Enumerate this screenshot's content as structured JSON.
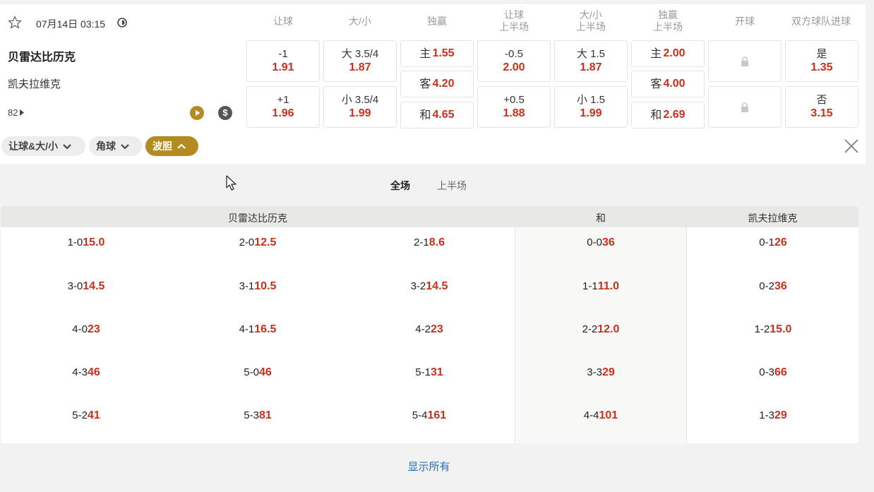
{
  "match": {
    "datetime": "07月14日 03:15",
    "home_team": "贝雷达比历克",
    "away_team": "凯夫拉维克",
    "more_count": "82"
  },
  "columns": [
    "让球",
    "大/小",
    "独赢",
    "让球\n上半场",
    "大/小\n上半场",
    "独赢\n上半场",
    "开球",
    "双方球队进球"
  ],
  "odds": {
    "handicap": [
      {
        "line": "-1",
        "odds": "1.91"
      },
      {
        "line": "+1",
        "odds": "1.96"
      }
    ],
    "total": [
      {
        "line": "大 3.5/4",
        "odds": "1.87"
      },
      {
        "line": "小 3.5/4",
        "odds": "1.99"
      }
    ],
    "moneyline": [
      {
        "label": "主",
        "odds": "1.55"
      },
      {
        "label": "客",
        "odds": "4.20"
      },
      {
        "label": "和",
        "odds": "4.65"
      }
    ],
    "handicap_1h": [
      {
        "line": "-0.5",
        "odds": "2.00"
      },
      {
        "line": "+0.5",
        "odds": "1.88"
      }
    ],
    "total_1h": [
      {
        "line": "大 1.5",
        "odds": "1.87"
      },
      {
        "line": "小 1.5",
        "odds": "1.99"
      }
    ],
    "moneyline_1h": [
      {
        "label": "主",
        "odds": "2.00"
      },
      {
        "label": "客",
        "odds": "4.00"
      },
      {
        "label": "和",
        "odds": "2.69"
      }
    ],
    "btts": [
      {
        "label": "是",
        "odds": "1.35"
      },
      {
        "label": "否",
        "odds": "3.15"
      }
    ]
  },
  "chips": [
    {
      "label": "让球&大/小",
      "active": false
    },
    {
      "label": "角球",
      "active": false
    },
    {
      "label": "波胆",
      "active": true
    }
  ],
  "tabs": [
    "全场",
    "上半场"
  ],
  "correct_score": {
    "headers": {
      "home": "贝雷达比历克",
      "draw": "和",
      "away": "凯夫拉维克"
    },
    "home": [
      [
        {
          "score": "1-0",
          "odds": "15.0"
        },
        {
          "score": "2-0",
          "odds": "12.5"
        },
        {
          "score": "2-1",
          "odds": "8.6"
        }
      ],
      [
        {
          "score": "3-0",
          "odds": "14.5"
        },
        {
          "score": "3-1",
          "odds": "10.5"
        },
        {
          "score": "3-2",
          "odds": "14.5"
        }
      ],
      [
        {
          "score": "4-0",
          "odds": "23"
        },
        {
          "score": "4-1",
          "odds": "16.5"
        },
        {
          "score": "4-2",
          "odds": "23"
        }
      ],
      [
        {
          "score": "4-3",
          "odds": "46"
        },
        {
          "score": "5-0",
          "odds": "46"
        },
        {
          "score": "5-1",
          "odds": "31"
        }
      ],
      [
        {
          "score": "5-2",
          "odds": "41"
        },
        {
          "score": "5-3",
          "odds": "81"
        },
        {
          "score": "5-4",
          "odds": "161"
        }
      ]
    ],
    "draw": [
      {
        "score": "0-0",
        "odds": "36"
      },
      {
        "score": "1-1",
        "odds": "11.0"
      },
      {
        "score": "2-2",
        "odds": "12.0"
      },
      {
        "score": "3-3",
        "odds": "29"
      },
      {
        "score": "4-4",
        "odds": "101"
      }
    ],
    "away": [
      {
        "score": "0-1",
        "odds": "26"
      },
      {
        "score": "0-2",
        "odds": "36"
      },
      {
        "score": "1-2",
        "odds": "15.0"
      },
      {
        "score": "0-3",
        "odds": "66"
      },
      {
        "score": "1-3",
        "odds": "29"
      }
    ]
  },
  "show_all_label": "显示所有",
  "colors": {
    "accent": "#b48a22",
    "odds_red": "#c9301c",
    "link_blue": "#2a6fb8"
  }
}
